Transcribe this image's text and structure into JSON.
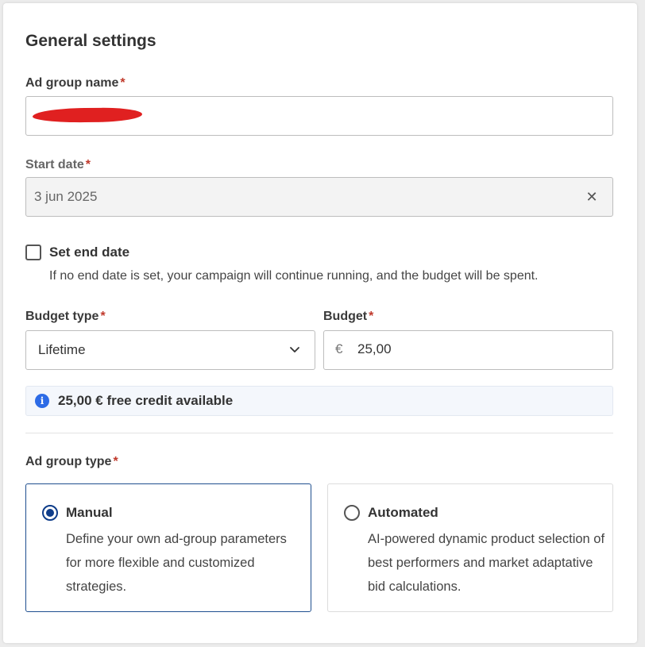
{
  "section_title": "General settings",
  "required_marker": "*",
  "ad_group_name": {
    "label": "Ad group name",
    "value": ""
  },
  "start_date": {
    "label": "Start date",
    "value": "3 jun 2025",
    "clear_icon": "close-icon"
  },
  "end_date": {
    "checkbox_label": "Set end date",
    "checked": false,
    "help_text": "If no end date is set, your campaign will continue running, and the budget will be spent."
  },
  "budget_type": {
    "label": "Budget type",
    "selected": "Lifetime"
  },
  "budget": {
    "label": "Budget",
    "currency": "€",
    "value": "25,00"
  },
  "credit_notice": {
    "icon": "info-icon",
    "icon_glyph": "i",
    "text": "25,00 € free credit available"
  },
  "ad_group_type": {
    "label": "Ad group type",
    "options": [
      {
        "title": "Manual",
        "description": "Define your own ad-group parameters for more flexible and customized strategies.",
        "selected": true
      },
      {
        "title": "Automated",
        "description": "AI-powered dynamic product selection of best performers and market adaptative bid calculations.",
        "selected": false
      }
    ]
  },
  "colors": {
    "required": "#c0392b",
    "accent": "#0f3d8a",
    "info": "#2d6be6",
    "redaction": "#e02020"
  }
}
